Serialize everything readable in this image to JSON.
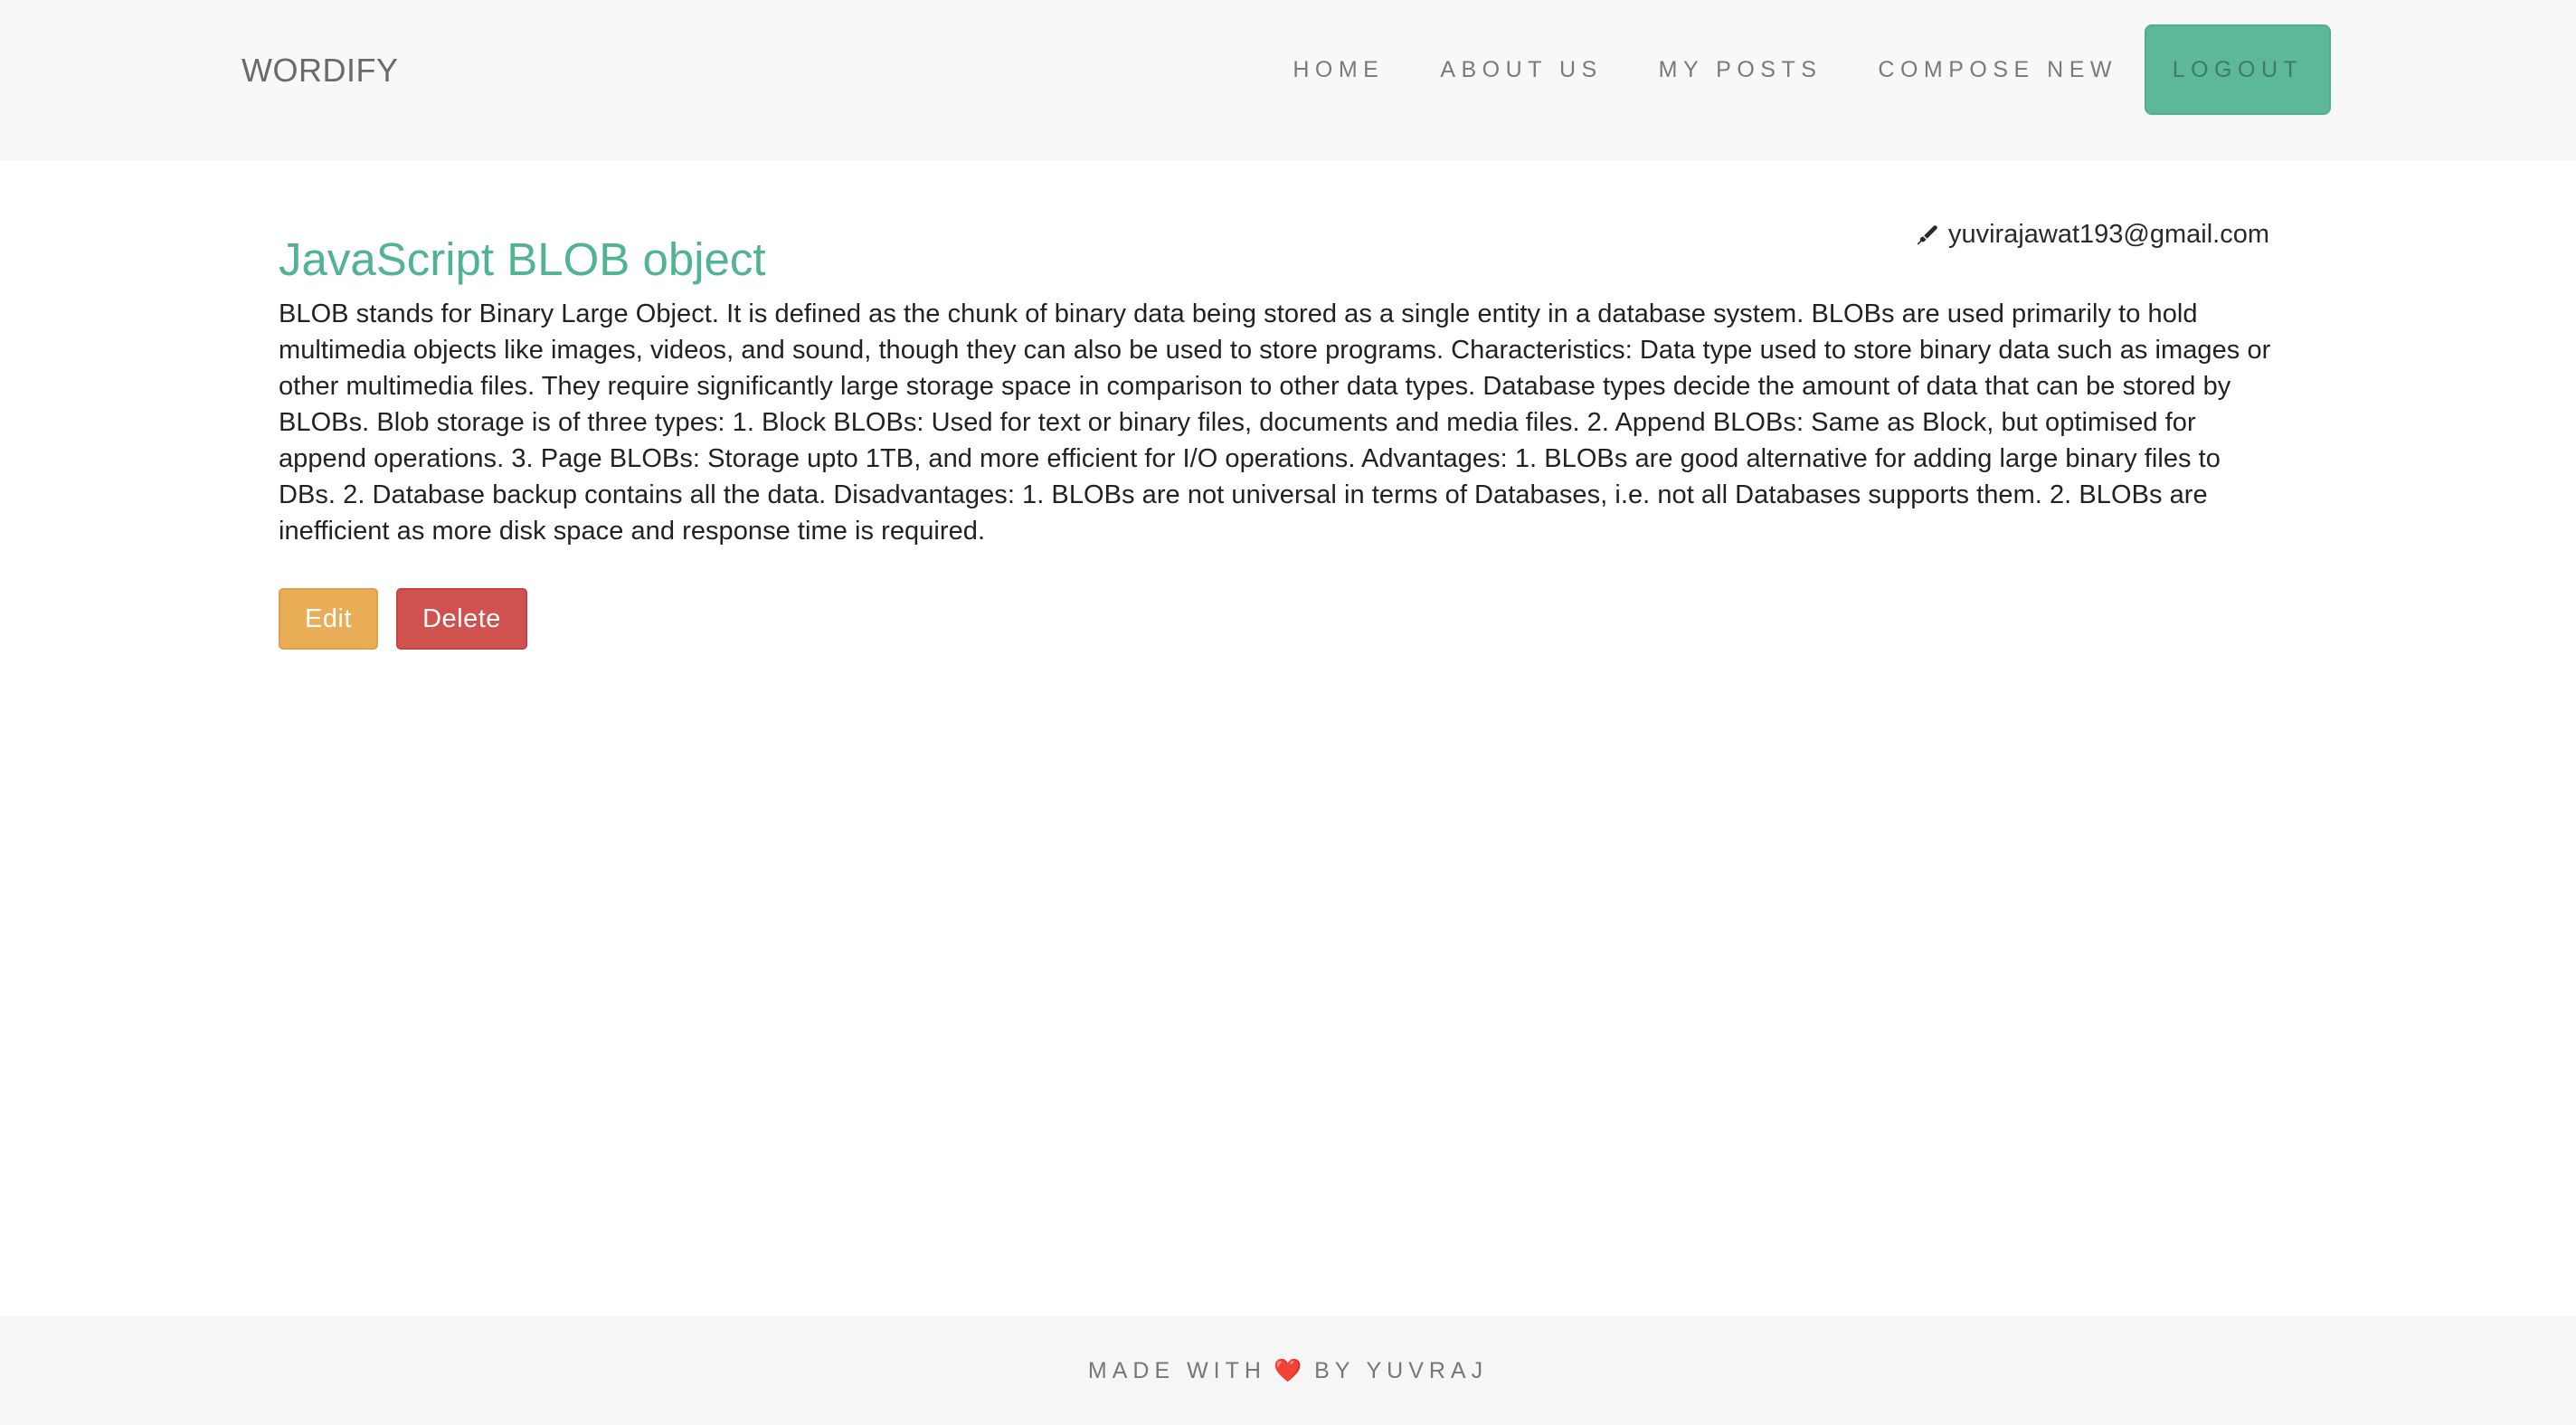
{
  "navbar": {
    "brand": "WORDIFY",
    "links": [
      "HOME",
      "ABOUT US",
      "MY POSTS",
      "COMPOSE NEW"
    ],
    "logout_label": "LOGOUT",
    "background_color": "#f8f8f8",
    "logout_color": "#5cb899"
  },
  "post": {
    "title": "JavaScript BLOB object",
    "author_email": "yuvirajawat193@gmail.com",
    "author_icon": "pen-icon",
    "body": "BLOB stands for Binary Large Object. It is defined as the chunk of binary data being stored as a single entity in a database system. BLOBs are used primarily to hold multimedia objects like images, videos, and sound, though they can also be used to store programs. Characteristics: Data type used to store binary data such as images or other multimedia files. They require significantly large storage space in comparison to other data types. Database types decide the amount of data that can be stored by BLOBs. Blob storage is of three types: 1. Block BLOBs: Used for text or binary files, documents and media files. 2. Append BLOBs: Same as Block, but optimised for append operations. 3. Page BLOBs: Storage upto 1TB, and more efficient for I/O operations. Advantages: 1. BLOBs are good alternative for adding large binary files to DBs. 2. Database backup contains all the data. Disadvantages: 1. BLOBs are not universal in terms of Databases, i.e. not all Databases supports them. 2. BLOBs are inefficient as more disk space and response time is required.",
    "title_color": "#52b394",
    "edit_label": "Edit",
    "delete_label": "Delete",
    "edit_color": "#e9ac57",
    "delete_color": "#d0524f"
  },
  "footer": {
    "prefix": "MADE WITH",
    "heart": "❤️",
    "suffix": "BY YUVRAJ"
  }
}
